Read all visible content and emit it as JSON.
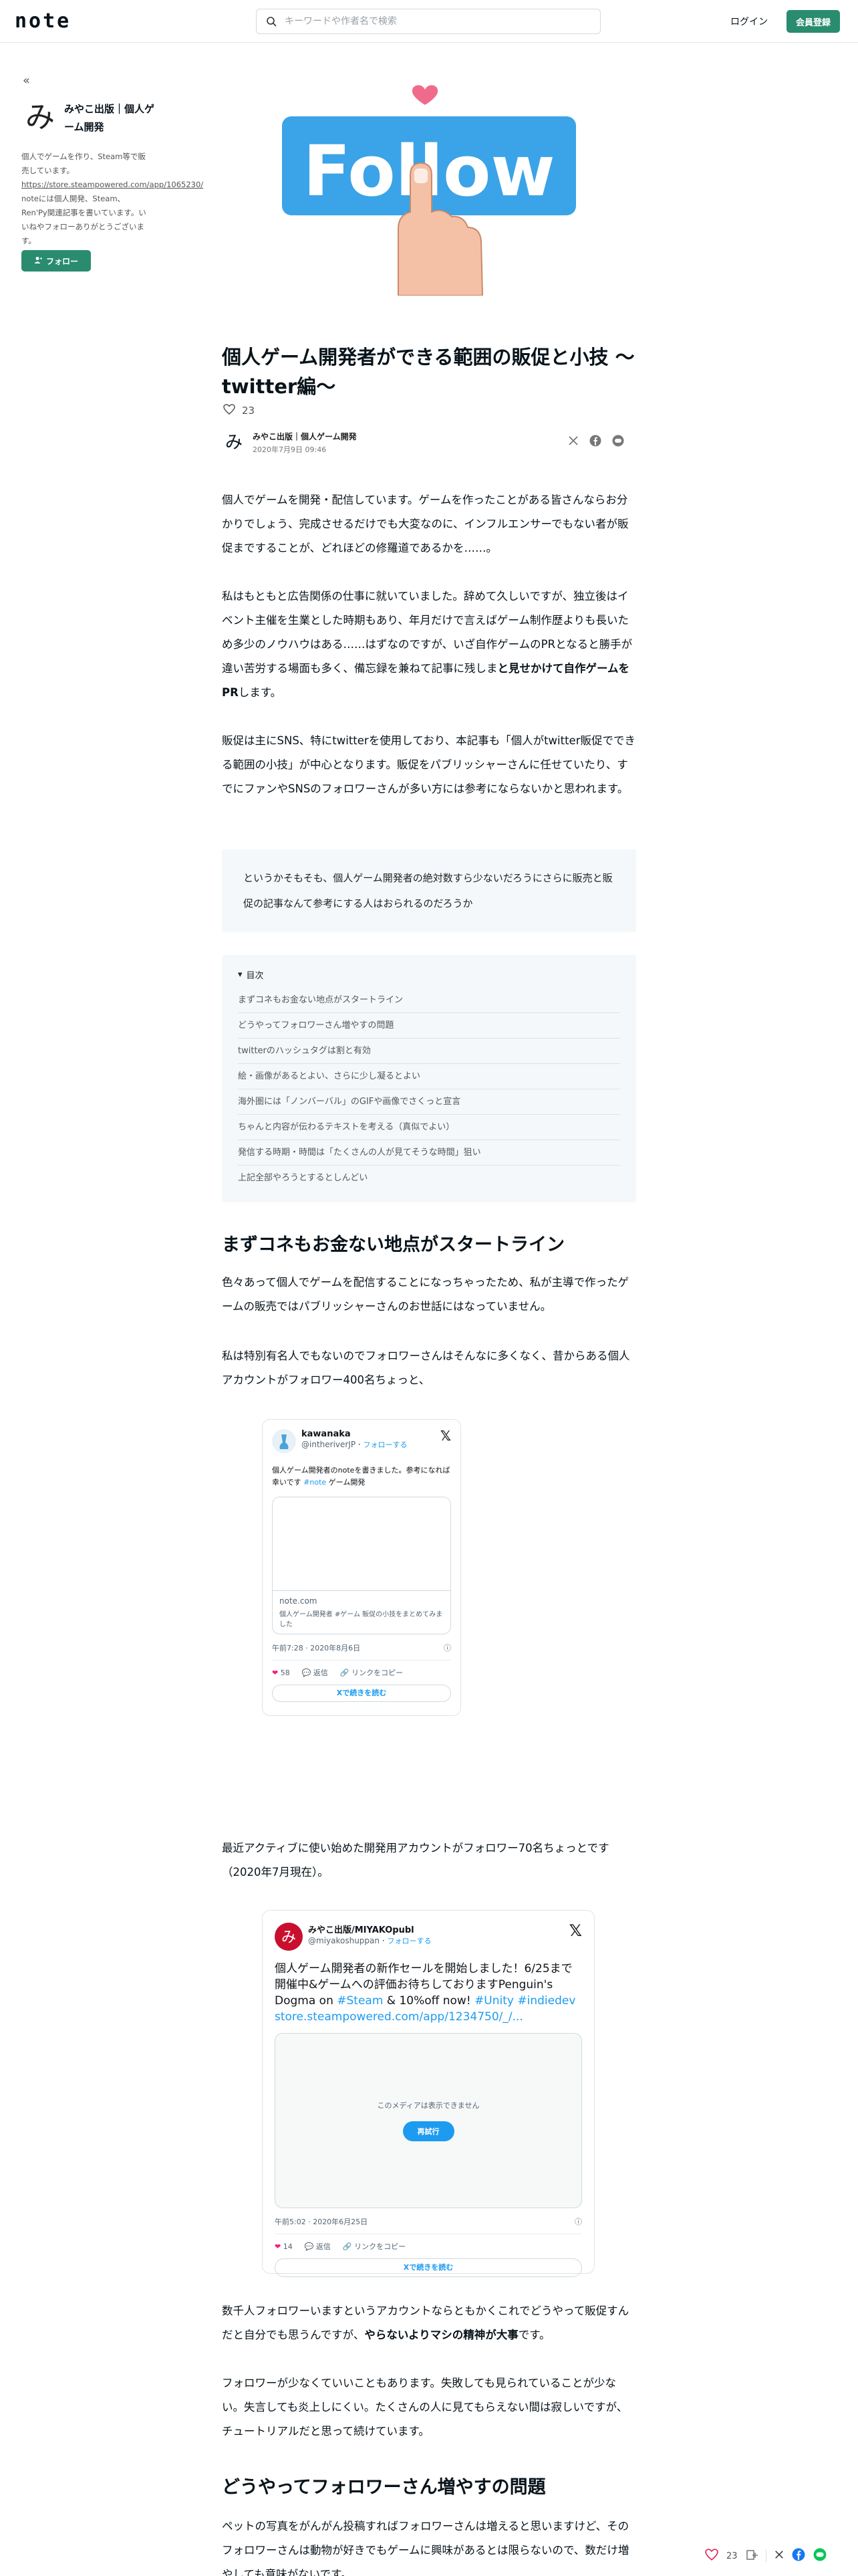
{
  "header": {
    "logo": "note",
    "search_placeholder": "キーワードや作者名で検索",
    "login": "ログイン",
    "signup": "会員登録"
  },
  "sidebar": {
    "collapse": "«",
    "avatar_char": "み",
    "name": "みやこ出版｜個人ゲーム開発",
    "bio_1": "個人でゲームを作り、Steam等で販売しています。",
    "bio_link": "https://store.steampowered.com/app/1065230/",
    "bio_2": " noteには個人開発、Steam、Ren'Py関連記事を書いています。いいねやフォローありがとうございます。",
    "follow": "フォロー"
  },
  "hero": {
    "word": "Follow",
    "colors": {
      "panel": "#3ba3e8",
      "hand": "#f4c1a6",
      "heart": "#f06b8b"
    }
  },
  "article": {
    "title": "個人ゲーム開発者ができる範囲の販促と小技 〜twitter編〜",
    "likes": "23",
    "author": "みやこ出版｜個人ゲーム開発",
    "date": "2020年7月9日 09:46",
    "p1": "個人でゲームを開発・配信しています。ゲームを作ったことがある皆さんならお分かりでしょう、完成させるだけでも大変なのに、インフルエンサーでもない者が販促まですることが、どれほどの修羅道であるかを……。",
    "p2a": "私はもともと広告関係の仕事に就いていました。辞めて久しいですが、独立後はイベント主催を生業とした時期もあり、年月だけで言えばゲーム制作歴よりも長いため多少のノウハウはある……はずなのですが、いざ自作ゲームのPRとなると勝手が違い苦労する場面も多く、備忘録を兼ねて記事に残しま",
    "p2b": "と見せかけて自作ゲームをPR",
    "p2c": "します。",
    "p3": "販促は主にSNS、特にtwitterを使用しており、本記事も「個人がtwitter販促でできる範囲の小技」が中心となります。販促をパブリッシャーさんに任せていたり、すでにファンやSNSのフォロワーさんが多い方には参考にならないかと思われます。",
    "quote": "というかそもそも、個人ゲーム開発者の絶対数すら少ないだろうにさらに販売と販促の記事なんて参考にする人はおられるのだろうか",
    "toc_title": "目次",
    "toc": [
      "まずコネもお金ない地点がスタートライン",
      "どうやってフォロワーさん増やすの問題",
      "twitterのハッシュタグは割と有効",
      "絵・画像があるとよい、さらに少し凝るとよい",
      "海外圏には「ノンバーバル」のGIFや画像でさくっと宣言",
      "ちゃんと内容が伝わるテキストを考える（真似でよい）",
      "発信する時期・時間は「たくさんの人が見てそうな時間」狙い",
      "上記全部やろうとするとしんどい"
    ],
    "h2_1": "まずコネもお金ない地点がスタートライン",
    "p4": "色々あって個人でゲームを配信することになっちゃったため、私が主導で作ったゲームの販売ではパブリッシャーさんのお世話にはなっていません。",
    "p5": "私は特別有名人でもないのでフォロワーさんはそんなに多くなく、昔からある個人アカウントがフォロワー400名ちょっと、",
    "p6": "最近アクティブに使い始めた開発用アカウントがフォロワー70名ちょっとです（2020年7月現在）。",
    "p7a": "数千人フォロワーいますというアカウントならともかくこれでどうやって販促すんだと自分でも思うんですが、",
    "p7b": "やらないよりマシの精神が大事",
    "p7c": "です。",
    "p8": "フォロワーが少なくていいこともあります。失敗しても見られていることが少ない。失言しても炎上しにくい。たくさんの人に見てもらえない間は寂しいですが、チュートリアルだと思って続けています。",
    "h2_2": "どうやってフォロワーさん増やすの問題",
    "p9": "ペットの写真をがんがん投稿すればフォロワーさんは増えると思いますけど、そのフォロワーさんは動物が好きでもゲームに興味があるとは限らないので、数だけ増やしても意味がないです。"
  },
  "tweet1": {
    "name": "kawanaka",
    "handle": "@intheriverJP",
    "follow": "フォローする",
    "text_1": "個人ゲーム開発者のnoteを書きました。参考になれば幸いです",
    "text_tag": "#note",
    "text_2": "ゲーム開発",
    "card_domain": "note.com",
    "card_title": "個人ゲーム開発者 #ゲーム 販促の小技をまとめてみました",
    "time": "午前7:28 · 2020年8月6日",
    "likes": "58",
    "reply": "返信",
    "copy": "リンクをコピー",
    "more": "Xで続きを読む"
  },
  "tweet2": {
    "name": "みやこ出版/MIYAKOpubl",
    "handle": "@miyakoshuppan",
    "follow": "フォローする",
    "text": "個人ゲーム開発者の新作セールを開始しました！6/25まで開催中&ゲームへの評価お待ちしておりますPenguin's Dogma on ",
    "tag1": "#Steam",
    "text_mid": " & 10%off now! ",
    "tag2": "#Unity",
    "tag3": " #indiedev",
    "url": "store.steampowered.com/app/1234750/_/...",
    "media_msg": "このメディアは表示できません",
    "media_btn": "再試行",
    "time": "午前5:02 · 2020年6月25日",
    "likes": "14",
    "reply": "返信",
    "copy": "リンクをコピー",
    "more": "Xで続きを読む"
  },
  "floatbar": {
    "likes": "23"
  }
}
